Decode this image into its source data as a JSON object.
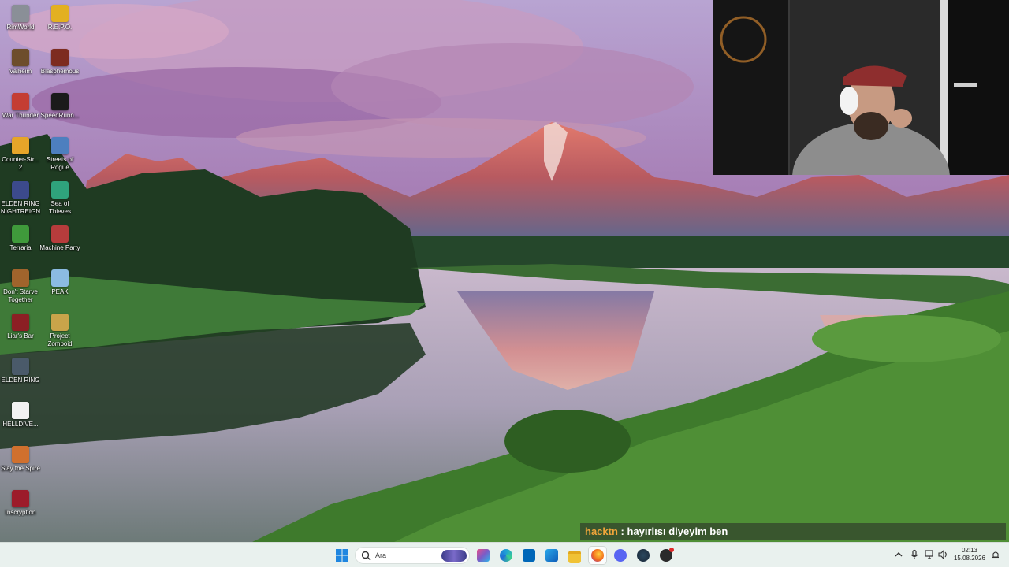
{
  "desktop": {
    "icons": [
      {
        "label": "RimWorld",
        "color": "#8a8f97"
      },
      {
        "label": "R.E.P.O.",
        "color": "#e3b021"
      },
      {
        "label": "Valheim",
        "color": "#6d4d2c"
      },
      {
        "label": "Blasphemous",
        "color": "#7d2b20"
      },
      {
        "label": "War Thunder",
        "color": "#c43d32"
      },
      {
        "label": "SpeedRunn...",
        "color": "#1a1a1a"
      },
      {
        "label": "Counter-Str... 2",
        "color": "#e6a529"
      },
      {
        "label": "Streets of Rogue",
        "color": "#4d7fbf"
      },
      {
        "label": "ELDEN RING NIGHTREIGN",
        "color": "#3c4a8c"
      },
      {
        "label": "Sea of Thieves",
        "color": "#2fa37c"
      },
      {
        "label": "Terraria",
        "color": "#3f9a3b"
      },
      {
        "label": "Machine Party",
        "color": "#b63c3c"
      },
      {
        "label": "Don't Starve Together",
        "color": "#a0642c"
      },
      {
        "label": "PEAK",
        "color": "#8bbbe2"
      },
      {
        "label": "Liar's Bar",
        "color": "#8c1f24"
      },
      {
        "label": "Project Zomboid",
        "color": "#c9a44a"
      },
      {
        "label": "ELDEN RING",
        "color": "#4a5a6a"
      },
      {
        "label": "HELLDIVE...",
        "color": "#f2f2f2"
      },
      {
        "label": "Slay the Spire",
        "color": "#d0702e"
      },
      {
        "label": "Inscryption",
        "color": "#9c1b2a"
      }
    ]
  },
  "chat": {
    "user": "hacktn",
    "separator": " : ",
    "message": "hayırlısı diyeyim ben"
  },
  "taskbar": {
    "search_text": "Ara",
    "pinned": [
      {
        "icon": "windows-start-icon",
        "color": "#2f8ce8"
      },
      {
        "icon": "task-view-icon",
        "color": "#7b5cc7"
      },
      {
        "icon": "edge-icon",
        "color": "#1fa0d6"
      },
      {
        "icon": "store-icon",
        "color": "#0067b8"
      },
      {
        "icon": "outlook-icon",
        "color": "#1d6fd1"
      },
      {
        "icon": "file-explorer-icon",
        "color": "#f0c235"
      },
      {
        "icon": "firefox-icon",
        "color": "#f26a1b"
      },
      {
        "icon": "discord-icon",
        "color": "#5865f2"
      },
      {
        "icon": "steam-icon",
        "color": "#1b2838"
      },
      {
        "icon": "obs-icon",
        "color": "#2a2a2a"
      }
    ],
    "clock_time": "02:13",
    "clock_date": "15.08.2026"
  }
}
